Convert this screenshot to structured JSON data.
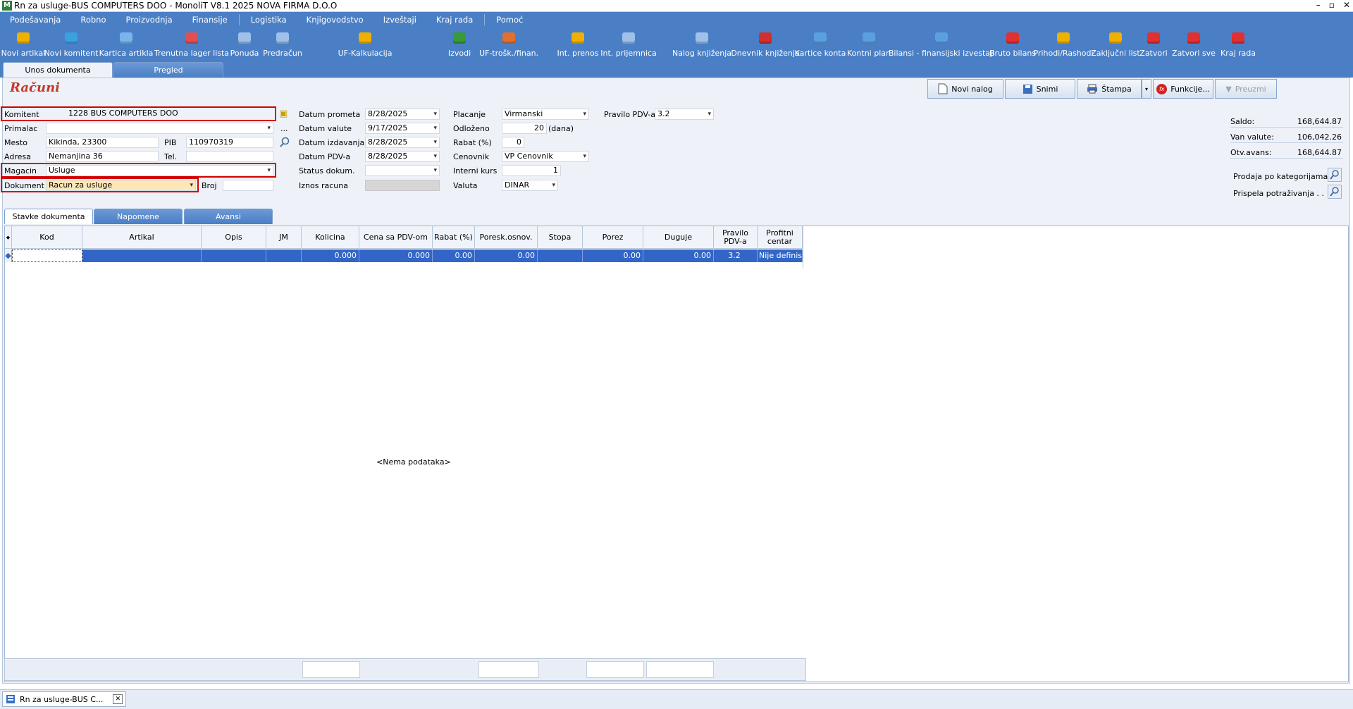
{
  "window": {
    "title": "Rn za usluge-BUS COMPUTERS DOO - MonoliT V8.1 2025 NOVA FIRMA D.O.O",
    "controls": [
      "–",
      "▫",
      "✕"
    ]
  },
  "menu": [
    "Podešavanja",
    "Robno",
    "Proizvodnja",
    "Finansije",
    "Logistika",
    "Knjigovodstvo",
    "Izveštaji",
    "Kraj rada",
    "Pomoć"
  ],
  "toolbar": [
    {
      "label": "Novi artikal",
      "icon": "new-item-icon",
      "color": "#f0b000"
    },
    {
      "label": "Novi komitent",
      "icon": "new-client-icon",
      "color": "#3aa0e0"
    },
    {
      "label": "Kartica artikla",
      "icon": "item-card-icon",
      "color": "#7ab4ec"
    },
    {
      "label": "Trenutna lager lista",
      "icon": "stock-list-icon",
      "color": "#e05050"
    },
    {
      "label": "Ponuda",
      "icon": "offer-icon",
      "color": "#9ec0ea"
    },
    {
      "label": "Predračun",
      "icon": "proforma-icon",
      "color": "#9ec0ea"
    },
    {
      "label": "UF-Kalkulacija",
      "icon": "calculation-icon",
      "color": "#f0b000"
    },
    {
      "label": "Izvodi",
      "icon": "statements-icon",
      "color": "#3a9a3a"
    },
    {
      "label": "UF-trošk./finan.",
      "icon": "costs-icon",
      "color": "#e07030"
    },
    {
      "label": "Int. prenos",
      "icon": "transfer-icon",
      "color": "#f0b000"
    },
    {
      "label": "Int. prijemnica",
      "icon": "receipt-icon",
      "color": "#9ec0ea"
    },
    {
      "label": "Nalog knjiženja",
      "icon": "posting-order-icon",
      "color": "#9ec0ea"
    },
    {
      "label": "Dnevnik knjiženja",
      "icon": "journal-icon",
      "color": "#d03030"
    },
    {
      "label": "Kartice konta",
      "icon": "account-cards-icon",
      "color": "#5aa0e0"
    },
    {
      "label": "Kontni plan",
      "icon": "chart-of-accounts-icon",
      "color": "#5aa0e0"
    },
    {
      "label": "Bilansi - finansijski izvestaji",
      "icon": "balance-icon",
      "color": "#5aa0e0"
    },
    {
      "label": "Bruto bilans",
      "icon": "gross-balance-icon",
      "color": "#e03030"
    },
    {
      "label": "Prihodi/Rashodi",
      "icon": "income-expense-icon",
      "color": "#f0b000"
    },
    {
      "label": "Zaključni list",
      "icon": "closing-sheet-icon",
      "color": "#f0b000"
    },
    {
      "label": "Zatvori",
      "icon": "close-icon",
      "color": "#e03030"
    },
    {
      "label": "Zatvori sve",
      "icon": "close-all-icon",
      "color": "#e03030"
    },
    {
      "label": "Kraj rada",
      "icon": "power-icon",
      "color": "#e03030"
    }
  ],
  "top_tabs": {
    "entry": "Unos dokumenta",
    "overview": "Pregled"
  },
  "page_title": "Računi",
  "action_buttons": {
    "new_order": "Novi nalog",
    "save": "Snimi",
    "print": "Štampa",
    "functions": "Funkcije...",
    "download": "Preuzmi"
  },
  "form": {
    "komitent_label": "Komitent",
    "komitent_value": "1228 BUS COMPUTERS DOO",
    "primalac_label": "Primalac",
    "primalac_value": "",
    "mesto_label": "Mesto",
    "mesto_value": "Kikinda, 23300",
    "pib_label": "PIB",
    "pib_value": "110970319",
    "adresa_label": "Adresa",
    "adresa_value": "Nemanjina 36",
    "tel_label": "Tel.",
    "tel_value": "",
    "magacin_label": "Magacin",
    "magacin_value": "Usluge",
    "dokument_label": "Dokument",
    "dokument_value": "Racun za usluge",
    "broj_label": "Broj",
    "broj_value": "",
    "dots": "...",
    "datum_prometa_label": "Datum prometa",
    "datum_prometa": "8/28/2025",
    "datum_valute_label": "Datum valute",
    "datum_valute": "9/17/2025",
    "datum_izdavanja_label": "Datum izdavanja",
    "datum_izdavanja": "8/28/2025",
    "datum_pdv_label": "Datum PDV-a",
    "datum_pdv": "8/28/2025",
    "status_label": "Status dokum.",
    "status_value": "",
    "iznos_label": "Iznos racuna",
    "placanje_label": "Placanje",
    "placanje_value": "Virmanski",
    "odlozeno_label": "Odloženo",
    "odlozeno_value": "20",
    "odlozeno_unit": "(dana)",
    "rabat_label": "Rabat (%)",
    "rabat_value": "0",
    "cenovnik_label": "Cenovnik",
    "cenovnik_value": "VP Cenovnik",
    "interni_kurs_label": "Interni kurs",
    "interni_kurs_value": "1",
    "valuta_label": "Valuta",
    "valuta_value": "DINAR",
    "pravilo_label": "Pravilo PDV-a",
    "pravilo_value": "3.2"
  },
  "summary": {
    "saldo_label": "Saldo:",
    "saldo": "168,644.87",
    "van_valute_label": "Van valute:",
    "van_valute": "106,042.26",
    "otv_avans_label": "Otv.avans:",
    "otv_avans": "168,644.87",
    "prodaja_label": "Prodaja po kategorijama",
    "prispela_label": "Prispela potraživanja . ."
  },
  "doc_tabs": [
    "Stavke dokumenta",
    "Napomene",
    "Avansi"
  ],
  "grid": {
    "columns": [
      "Kod",
      "Artikal",
      "Opis",
      "JM",
      "Kolicina",
      "Cena sa PDV-om",
      "Rabat (%)",
      "Poresk.osnov.",
      "Stopa",
      "Porez",
      "Duguje",
      "Pravilo PDV-a",
      "Profitni centar"
    ],
    "row": [
      "",
      "",
      "",
      "",
      "0.000",
      "0.000",
      "0.00",
      "0.00",
      "",
      "0.00",
      "0.00",
      "3.2",
      "Nije definisan"
    ],
    "empty_text": "<Nema podataka>"
  },
  "statusbar": {
    "doc_tab": "Rn za usluge-BUS C..."
  }
}
